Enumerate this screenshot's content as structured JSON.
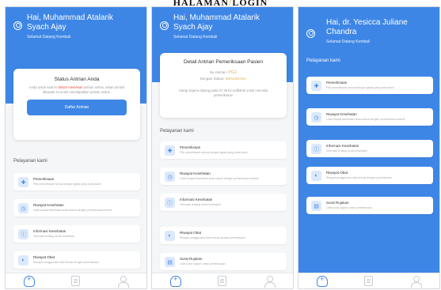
{
  "page_title": {
    "left": "HALAMAN",
    "separator": "/",
    "right": "LOGIN"
  },
  "screens": [
    {
      "greeting_line1": "Hai, Muhammad Atalarik",
      "greeting_line2": "Syach Ajay",
      "greeting_sub": "Selamat Datang Kembali",
      "card": {
        "title": "Status Antrian Anda",
        "desc_prefix": "Anda untuk saat ini",
        "desc_highlight": "belum memesan",
        "desc_suffix": "antrian online, tekan tombol dibawah ini untuk mendapatkan antrian online.",
        "button": "Daftar Antrian"
      },
      "section_title": "Pelayanan kami",
      "services": [
        {
          "title": "Pemeriksaan",
          "desc": "Pilih pemeriksaan sesuai dengan gejala yang anda alami"
        },
        {
          "title": "Riwayat Kesehatan",
          "desc": "Lihat riwayat kesehatan anda sesuai dengan pemeriksaan terakhir"
        },
        {
          "title": "Informasi Kesehatan",
          "desc": "Informasi tentang dunia kesehatan"
        },
        {
          "title": "Riwayat Obat",
          "desc": "Riwayat penggunaan obat sesuai dengan pemeriksaan"
        }
      ]
    },
    {
      "greeting_line1": "Hai, Muhammad Atalarik",
      "greeting_line2": "Syach Ajay",
      "greeting_sub": "Selamat Datang Kembali",
      "card": {
        "title": "Detail Antrian Pemeriksaan Pasien",
        "queue_label": "No Antrian:",
        "queue_code": "PG1",
        "status_label": "Dengan Status:",
        "status_value": "MENUNGGU",
        "note": "Harap segera datang pada 07.30 ke poliklinik untuk memulai pemeriksaan"
      },
      "section_title": "Pelayanan kami",
      "services": [
        {
          "title": "Pemeriksaan",
          "desc": "Pilih pemeriksaan sesuai dengan gejala yang anda alami"
        },
        {
          "title": "Riwayat Kesehatan",
          "desc": "Lihat riwayat kesehatan anda sesuai dengan pemeriksaan terakhir"
        },
        {
          "title": "Informasi Kesehatan",
          "desc": "Informasi tentang dunia kesehatan"
        },
        {
          "title": "Riwayat Obat",
          "desc": "Riwayat penggunaan obat sesuai dengan pemeriksaan"
        },
        {
          "title": "Surat Rujukan",
          "desc": "Lihat surat rujukan untuk pemeriksaan"
        }
      ]
    },
    {
      "greeting_line1": "Hai, dr. Yesicca Juliane",
      "greeting_line2": "Chandra",
      "greeting_sub": "Selamat Datang Kembali",
      "section_title": "Pelayanan kami",
      "services": [
        {
          "title": "Pemeriksaan",
          "desc": "Pilih pemeriksaan sesuai dengan gejala yang anda alami"
        },
        {
          "title": "Riwayat Kesehatan",
          "desc": "Lihat riwayat kesehatan anda sesuai dengan pemeriksaan terakhir"
        },
        {
          "title": "Informasi Kesehatan",
          "desc": "Informasi tentang dunia kesehatan"
        },
        {
          "title": "Riwayat Obat",
          "desc": "Riwayat penggunaan obat sesuai dengan pemeriksaan"
        },
        {
          "title": "Surat Rujukan",
          "desc": "Lihat surat rujukan untuk pemeriksaan"
        }
      ]
    }
  ],
  "colors": {
    "primary": "#3e86e6",
    "highlight": "#e0463c",
    "status": "#e0b24a",
    "background": "#f5f6f8"
  },
  "icons": {
    "services": [
      "stethoscope-icon",
      "history-icon",
      "info-icon",
      "pill-icon",
      "document-icon"
    ],
    "nav": [
      "home-icon",
      "document-icon",
      "user-icon"
    ]
  }
}
